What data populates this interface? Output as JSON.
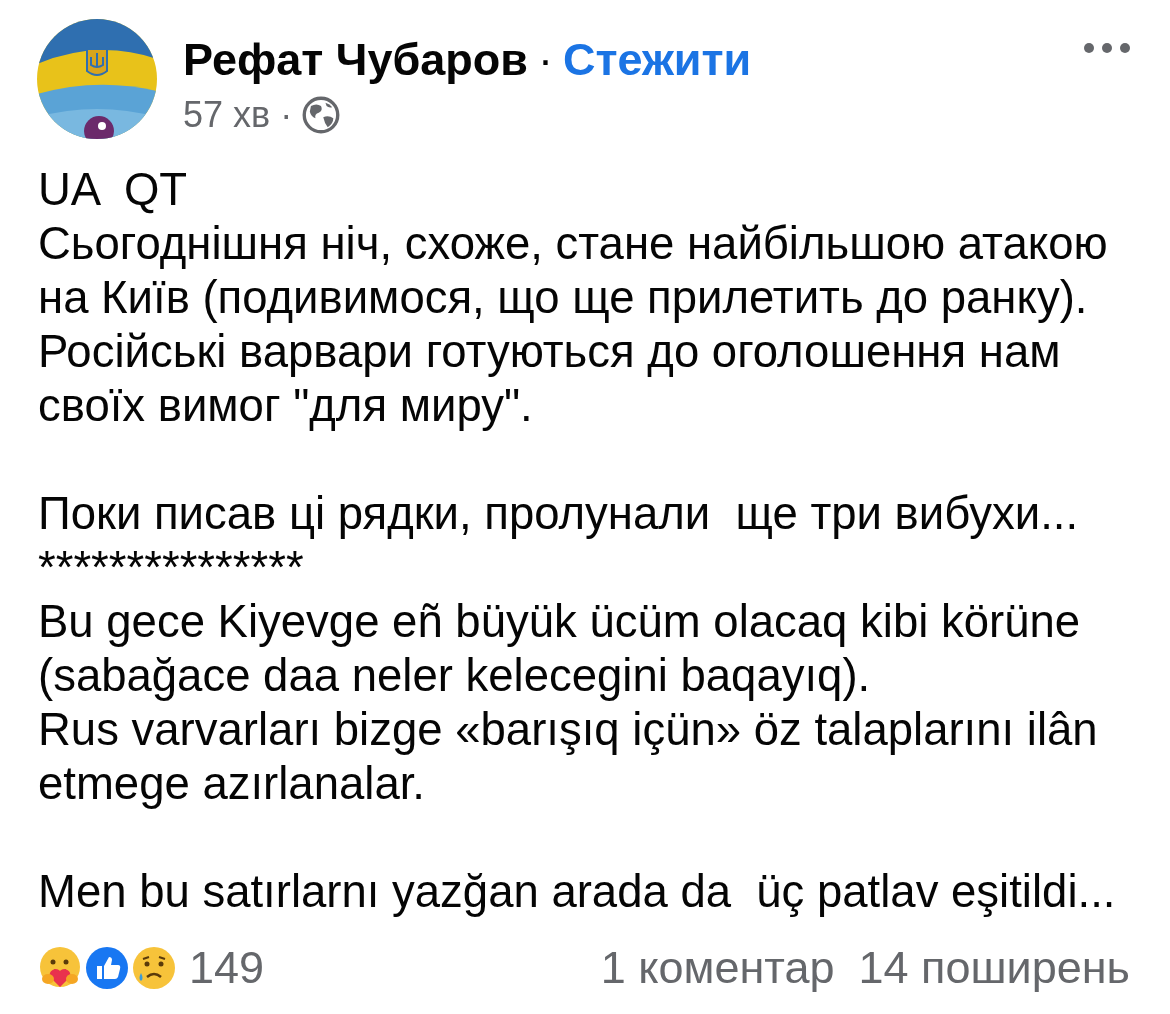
{
  "post": {
    "author": "Рефат Чубаров",
    "separator": "·",
    "follow": "Стежити",
    "time": "57 хв",
    "time_separator": "·",
    "blocks": [
      [
        "UA  QT\nСьогоднішня ніч, схоже, стане найбільшою атакою\nна Київ (подивимося, що ще прилетить до ранку).\nРосійські варвари готуються до оголошення нам\nсвоїх вимог \"для миру\"."
      ],
      [
        "Поки писав ці рядки, пролунали  ще три вибухи...",
        "***************",
        "Bu gece Kiyevge eñ büyük ücüm olacaq kibi körüne\n(sabağace daa neler kelecegini baqayıq).\nRus varvarları bizge «barışıq içün» öz talaplarını ilân\netmege azırlanalar."
      ],
      [
        "Men bu satırlarnı yazğan arada da  üç patlav eşitildi..."
      ]
    ],
    "reactions": [
      {
        "kind": "care"
      },
      {
        "kind": "like"
      },
      {
        "kind": "sad"
      }
    ],
    "reaction_count": "149",
    "comments": "1 коментар",
    "shares": "14 поширень"
  }
}
